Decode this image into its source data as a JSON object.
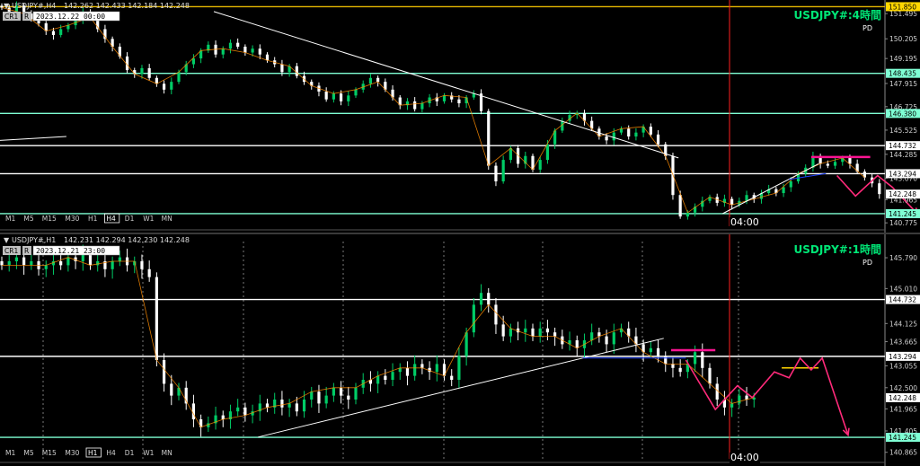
{
  "chart_data": [
    {
      "type": "candlestick",
      "symbol_header": "USDJPY#,H4",
      "ohlc_readout": "142.262 142.433 142.184 142.248",
      "chart_label": "CR1",
      "r_label": "R",
      "date_box": "2023.12.22 00:00",
      "big_title": "USDJPY#:4時間",
      "subtitle": "PD",
      "time_marker": "04:00",
      "timeframes": [
        "M1",
        "M5",
        "M15",
        "M30",
        "H1",
        "H4",
        "D1",
        "W1",
        "MN"
      ],
      "active_timeframe": "H4",
      "price_range": [
        140.6,
        152.1
      ],
      "y_ticks": [
        151.495,
        150.205,
        149.195,
        147.915,
        146.725,
        145.525,
        144.285,
        143.07,
        141.965,
        140.775
      ],
      "level_labels": [
        {
          "value": 151.85,
          "label": "151.850",
          "bg": "#ffd700"
        },
        {
          "value": 148.435,
          "label": "148.435",
          "bg": "#7fffd4"
        },
        {
          "value": 146.38,
          "label": "146.380",
          "bg": "#7fffd4"
        },
        {
          "value": 144.732,
          "label": "144.732",
          "bg": "#ffffff"
        },
        {
          "value": 143.294,
          "label": "143.294",
          "bg": "#ffffff"
        },
        {
          "value": 142.248,
          "label": "142.248",
          "bg": "#ffffff"
        },
        {
          "value": 141.245,
          "label": "141.245",
          "bg": "#7fffd4"
        }
      ],
      "support_resistance": [
        {
          "value": 151.85,
          "color": "#e6b800"
        },
        {
          "value": 148.435,
          "color": "#7fffd4"
        },
        {
          "value": 146.38,
          "color": "#7fffd4"
        },
        {
          "value": 144.732,
          "color": "#ffffff"
        },
        {
          "value": 143.294,
          "color": "#ffffff"
        },
        {
          "value": 141.245,
          "color": "#7fffd4"
        }
      ],
      "colors": {
        "bull": "#00cc66",
        "bear": "#ffffff",
        "title": "#00e676",
        "forecast": "#ff2a7a",
        "zigzag": "#ff8c00",
        "current": "#ff2020",
        "grid_dash": "#7a7a7a"
      },
      "x_count": 120,
      "closes": [
        151.8,
        151.6,
        151.9,
        151.5,
        151.2,
        151.0,
        150.6,
        150.4,
        150.7,
        150.9,
        151.2,
        151.6,
        151.3,
        150.7,
        150.2,
        149.8,
        149.3,
        148.6,
        148.4,
        148.7,
        148.2,
        147.9,
        147.6,
        148.0,
        148.5,
        148.9,
        149.2,
        149.6,
        149.9,
        149.4,
        149.7,
        150.0,
        149.8,
        149.5,
        149.7,
        149.4,
        149.1,
        148.9,
        148.5,
        148.8,
        148.3,
        148.0,
        147.8,
        147.5,
        147.1,
        147.4,
        147.0,
        147.3,
        147.6,
        147.9,
        148.2,
        148.0,
        147.6,
        147.2,
        146.8,
        147.0,
        146.6,
        146.9,
        147.2,
        147.0,
        147.3,
        147.1,
        146.9,
        147.2,
        147.4,
        146.5,
        143.7,
        142.9,
        144.0,
        144.6,
        143.8,
        144.2,
        143.5,
        144.0,
        144.8,
        145.5,
        146.0,
        146.3,
        146.4,
        146.0,
        145.6,
        145.2,
        145.0,
        145.4,
        145.6,
        145.2,
        145.4,
        145.7,
        145.3,
        144.8,
        144.2,
        142.2,
        141.1,
        141.3,
        141.6,
        141.9,
        142.1,
        141.8,
        142.0,
        141.7,
        141.9,
        142.2,
        142.0,
        142.3,
        142.5,
        142.3,
        142.6,
        142.9,
        143.3,
        143.6,
        144.2,
        143.8,
        143.7,
        143.9,
        144.1,
        143.8,
        143.4,
        143.1,
        142.8,
        142.25
      ],
      "diagonal_lines": [
        {
          "x0": 29,
          "y0": 151.6,
          "x1": 92,
          "y1": 144.1,
          "color": "#ffffff"
        },
        {
          "x0": 98,
          "y0": 141.25,
          "x1": 111,
          "y1": 143.8,
          "color": "#ffffff"
        },
        {
          "x0": 0,
          "y0": 145.0,
          "x1": 9,
          "y1": 145.2,
          "color": "#ffffff"
        },
        {
          "x0": 107,
          "y0": 143.0,
          "x1": 112,
          "y1": 143.3,
          "color": "#1e40ff"
        }
      ],
      "magenta_segment": {
        "x0": 110,
        "x1": 118,
        "y": 144.15
      },
      "forecast": {
        "x": [
          113.5,
          116.0,
          119.0,
          121.0,
          124.5
        ],
        "y": [
          143.2,
          142.15,
          143.2,
          142.6,
          141.2
        ]
      }
    },
    {
      "type": "candlestick",
      "symbol_header": "USDJPY#,H1",
      "ohlc_readout": "142.231 142.294 142.230 142.248",
      "chart_label": "CR1",
      "r_label": "R",
      "date_box": "2023.12.21 23:00",
      "big_title": "USDJPY#:1時間",
      "subtitle": "PD",
      "time_marker": "04:00",
      "timeframes": [
        "M1",
        "M5",
        "M15",
        "M30",
        "H1",
        "H4",
        "D1",
        "W1",
        "MN"
      ],
      "active_timeframe": "H1",
      "price_range": [
        140.7,
        146.2
      ],
      "y_ticks": [
        145.79,
        145.01,
        144.125,
        143.665,
        143.055,
        142.5,
        141.965,
        141.405,
        140.865
      ],
      "level_labels": [
        {
          "value": 144.732,
          "label": "144.732",
          "bg": "#ffffff"
        },
        {
          "value": 143.294,
          "label": "143.294",
          "bg": "#ffffff"
        },
        {
          "value": 142.248,
          "label": "142.248",
          "bg": "#ffffff"
        },
        {
          "value": 141.245,
          "label": "141.245",
          "bg": "#7fffd4"
        }
      ],
      "support_resistance": [
        {
          "value": 144.732,
          "color": "#ffffff"
        },
        {
          "value": 143.294,
          "color": "#ffffff"
        },
        {
          "value": 141.245,
          "color": "#7fffd4"
        }
      ],
      "colors": {
        "bull": "#00cc66",
        "bear": "#ffffff",
        "title": "#00e676",
        "forecast": "#ff2a7a",
        "zigzag": "#ff8c00",
        "current": "#ff2020",
        "grid_dash": "#7a7a7a"
      },
      "x_count": 120,
      "closes": [
        145.6,
        145.7,
        145.8,
        145.6,
        145.7,
        145.5,
        145.6,
        145.7,
        145.6,
        145.8,
        145.7,
        145.9,
        145.6,
        145.7,
        145.5,
        145.7,
        145.8,
        145.6,
        145.7,
        145.5,
        145.3,
        143.2,
        142.6,
        142.3,
        142.5,
        142.1,
        141.7,
        141.5,
        141.6,
        141.8,
        141.7,
        141.9,
        142.0,
        141.8,
        141.9,
        142.1,
        142.0,
        142.2,
        142.0,
        142.1,
        141.9,
        142.2,
        142.4,
        142.1,
        142.3,
        142.5,
        142.3,
        142.2,
        142.5,
        142.7,
        142.6,
        142.8,
        142.7,
        142.9,
        143.0,
        142.8,
        143.1,
        143.0,
        142.9,
        143.1,
        142.8,
        142.7,
        143.3,
        143.9,
        144.6,
        144.9,
        144.6,
        144.1,
        143.8,
        144.0,
        143.9,
        144.0,
        143.8,
        144.0,
        143.9,
        143.8,
        143.6,
        143.7,
        143.5,
        143.7,
        143.9,
        143.8,
        143.6,
        143.9,
        144.0,
        143.8,
        143.6,
        143.4,
        143.5,
        143.3,
        143.1,
        143.0,
        142.9,
        143.1,
        143.4,
        143.0,
        142.6,
        142.2,
        142.0,
        142.1,
        142.3,
        142.2,
        142.25
      ],
      "diagonal_lines": [
        {
          "x0": 35,
          "y0": 141.25,
          "x1": 90,
          "y1": 143.75,
          "color": "#ffffff"
        },
        {
          "x0": 79,
          "y0": 143.25,
          "x1": 93,
          "y1": 143.25,
          "color": "#1e40ff"
        }
      ],
      "magenta_segment": {
        "x0": 91,
        "x1": 97,
        "y": 143.45
      },
      "yellow_segment": {
        "x0": 106,
        "x1": 111,
        "y": 143.0
      },
      "forecast": {
        "x": [
          93.0,
          97.0,
          100.0,
          102.0,
          105.0,
          107.0,
          108.5,
          110.0,
          111.5,
          115.0
        ],
        "y": [
          143.2,
          141.95,
          142.55,
          142.25,
          142.9,
          142.75,
          143.25,
          142.95,
          143.25,
          141.3
        ]
      }
    }
  ]
}
